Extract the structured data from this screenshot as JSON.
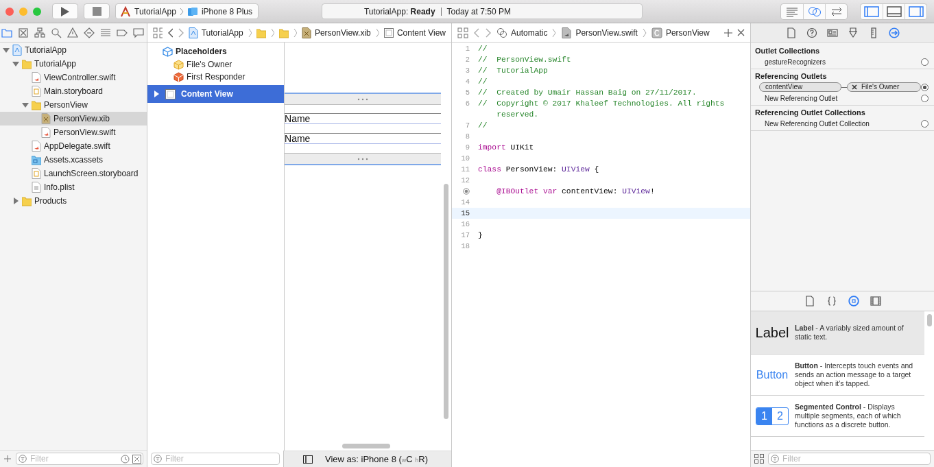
{
  "toolbar": {
    "scheme": "TutorialApp",
    "device": "iPhone 8 Plus",
    "activity": {
      "status": "TutorialApp: **Ready**",
      "time": "Today at 7:50 PM"
    },
    "editor_modes": [
      {
        "kind": "standard",
        "selected": false
      },
      {
        "kind": "assistant",
        "selected": true
      },
      {
        "kind": "version",
        "selected": false
      }
    ],
    "panels": [
      {
        "kind": "navigator",
        "selected": true
      },
      {
        "kind": "debug",
        "selected": false
      },
      {
        "kind": "utilities",
        "selected": true
      }
    ]
  },
  "navigator": {
    "tabs": [
      {
        "kind": "project",
        "selected": true
      },
      {
        "kind": "source",
        "selected": false
      },
      {
        "kind": "symbol",
        "selected": false
      },
      {
        "kind": "find",
        "selected": false
      },
      {
        "kind": "issue",
        "selected": false
      },
      {
        "kind": "test",
        "selected": false
      },
      {
        "kind": "debug",
        "selected": false
      },
      {
        "kind": "breakpoint",
        "selected": false
      },
      {
        "kind": "report",
        "selected": false
      }
    ],
    "items": [
      {
        "name": "TutorialApp",
        "kind": "project",
        "expanded": true,
        "selected": false,
        "children": [
          {
            "name": "TutorialApp",
            "kind": "folder",
            "expanded": true,
            "selected": false,
            "children": [
              {
                "name": "ViewController.swift",
                "kind": "swift",
                "selected": false
              },
              {
                "name": "Main.storyboard",
                "kind": "storyboard",
                "selected": false
              },
              {
                "name": "PersonView",
                "kind": "folder",
                "expanded": true,
                "selected": false,
                "children": [
                  {
                    "name": "PersonView.xib",
                    "kind": "xib",
                    "selected": true
                  },
                  {
                    "name": "PersonView.swift",
                    "kind": "swift",
                    "selected": false
                  }
                ]
              },
              {
                "name": "AppDelegate.swift",
                "kind": "swift",
                "selected": false
              },
              {
                "name": "Assets.xcassets",
                "kind": "assets",
                "selected": false
              },
              {
                "name": "LaunchScreen.storyboard",
                "kind": "storyboard",
                "selected": false
              },
              {
                "name": "Info.plist",
                "kind": "plist",
                "selected": false
              }
            ]
          },
          {
            "name": "Products",
            "kind": "folder",
            "expanded": false,
            "selected": false
          }
        ]
      }
    ],
    "filter_placeholder": "Filter"
  },
  "ib_editor": {
    "jump_bar": [
      {
        "kind": "project",
        "label": "TutorialApp"
      },
      {
        "kind": "folder"
      },
      {
        "kind": "folder"
      },
      {
        "kind": "xib",
        "label": "PersonView.xib"
      },
      {
        "kind": "view",
        "label": "Content View"
      }
    ],
    "outline": {
      "header": "Placeholders",
      "placeholders": [
        {
          "kind": "owner",
          "label": "File's Owner"
        },
        {
          "kind": "responder",
          "label": "First Responder"
        }
      ],
      "objects": [
        {
          "label": "Content View",
          "selected": true,
          "expanded": false
        }
      ],
      "filter_placeholder": "Filter"
    },
    "canvas": {
      "labels": [
        "Name",
        "Name"
      ],
      "view_as": "View as: iPhone 8 ($_{w}$C $_{h}$R)"
    }
  },
  "code_editor": {
    "jump_bar": [
      {
        "kind": "automatic",
        "label": "Automatic"
      },
      {
        "kind": "swift",
        "label": "PersonView.swift"
      },
      {
        "kind": "class",
        "label": "PersonView"
      }
    ],
    "lines": [
      {
        "number": "1",
        "current": false,
        "outlet": false,
        "tokens": [
          {
            "text": "//",
            "kind": "comment"
          }
        ]
      },
      {
        "number": "2",
        "current": false,
        "outlet": false,
        "tokens": [
          {
            "text": "//  PersonView.swift",
            "kind": "comment"
          }
        ]
      },
      {
        "number": "3",
        "current": false,
        "outlet": false,
        "tokens": [
          {
            "text": "//  TutorialApp",
            "kind": "comment"
          }
        ]
      },
      {
        "number": "4",
        "current": false,
        "outlet": false,
        "tokens": [
          {
            "text": "//",
            "kind": "comment"
          }
        ]
      },
      {
        "number": "5",
        "current": false,
        "outlet": false,
        "tokens": [
          {
            "text": "//  Created by Umair Hassan Baig on 27/11/2017.",
            "kind": "comment"
          }
        ]
      },
      {
        "number": "6",
        "current": false,
        "outlet": false,
        "tokens": [
          {
            "text": "//  Copyright © 2017 Khaleef Technologies. All rights reserved.",
            "kind": "comment"
          }
        ]
      },
      {
        "number": "7",
        "current": false,
        "outlet": false,
        "tokens": [
          {
            "text": "//",
            "kind": "comment"
          }
        ]
      },
      {
        "number": "8",
        "current": false,
        "outlet": false
      },
      {
        "number": "9",
        "current": false,
        "outlet": false,
        "tokens": [
          {
            "text": "import",
            "kind": "keyword"
          },
          {
            "text": " UIKit",
            "kind": "plain"
          }
        ]
      },
      {
        "number": "10",
        "current": false,
        "outlet": false
      },
      {
        "number": "11",
        "current": false,
        "outlet": false,
        "tokens": [
          {
            "text": "class",
            "kind": "keyword"
          },
          {
            "text": " PersonView: ",
            "kind": "plain"
          },
          {
            "text": "UIView",
            "kind": "type"
          },
          {
            "text": " {",
            "kind": "plain"
          }
        ]
      },
      {
        "number": "12",
        "current": false,
        "outlet": false
      },
      {
        "current": false,
        "outlet": true,
        "tokens": [
          {
            "text": "    @IBOutlet",
            "kind": "keyword"
          },
          {
            "text": " var",
            "kind": "keyword"
          },
          {
            "text": " contentView: ",
            "kind": "plain"
          },
          {
            "text": "UIView",
            "kind": "type"
          },
          {
            "text": "!",
            "kind": "plain"
          }
        ]
      },
      {
        "number": "14",
        "current": false,
        "outlet": false
      },
      {
        "number": "15",
        "current": true,
        "outlet": false
      },
      {
        "number": "16",
        "current": false,
        "outlet": false
      },
      {
        "number": "17",
        "current": false,
        "outlet": false,
        "tokens": [
          {
            "text": "}",
            "kind": "plain"
          }
        ]
      },
      {
        "number": "18",
        "current": false,
        "outlet": false
      }
    ]
  },
  "inspector": {
    "tabs": [
      {
        "kind": "file",
        "selected": false
      },
      {
        "kind": "help",
        "selected": false
      },
      {
        "kind": "identity",
        "selected": false
      },
      {
        "kind": "attributes",
        "selected": false
      },
      {
        "kind": "size",
        "selected": false
      },
      {
        "kind": "connections",
        "selected": true
      }
    ],
    "sections": [
      {
        "title": "Outlet Collections",
        "rows": [
          {
            "label": "gestureRecognizers",
            "connected": false
          }
        ]
      },
      {
        "title": "Referencing Outlets",
        "rows": [
          {
            "label": "contentView",
            "target": "File's Owner",
            "connected": true
          },
          {
            "label": "New Referencing Outlet",
            "connected": false
          }
        ]
      },
      {
        "title": "Referencing Outlet Collections",
        "rows": [
          {
            "label": "New Referencing Outlet Collection",
            "connected": false
          }
        ]
      }
    ]
  },
  "library": {
    "tabs": [
      {
        "kind": "file",
        "selected": false
      },
      {
        "kind": "snippet",
        "selected": false
      },
      {
        "kind": "object",
        "selected": true
      },
      {
        "kind": "media",
        "selected": false
      }
    ],
    "items": [
      {
        "kind": "label",
        "preview": "Label",
        "text": "**Label** - A variably sized amount of static text.",
        "selected": true
      },
      {
        "kind": "button",
        "preview": "Button",
        "text": "**Button** - Intercepts touch events and sends an action message to a target object when it's tapped.",
        "selected": false
      },
      {
        "kind": "segmented",
        "segments": [
          "1",
          "2"
        ],
        "text": "**Segmented Control** - Displays multiple segments, each of which functions as a discrete button.",
        "selected": false
      }
    ],
    "filter_placeholder": "Filter"
  }
}
